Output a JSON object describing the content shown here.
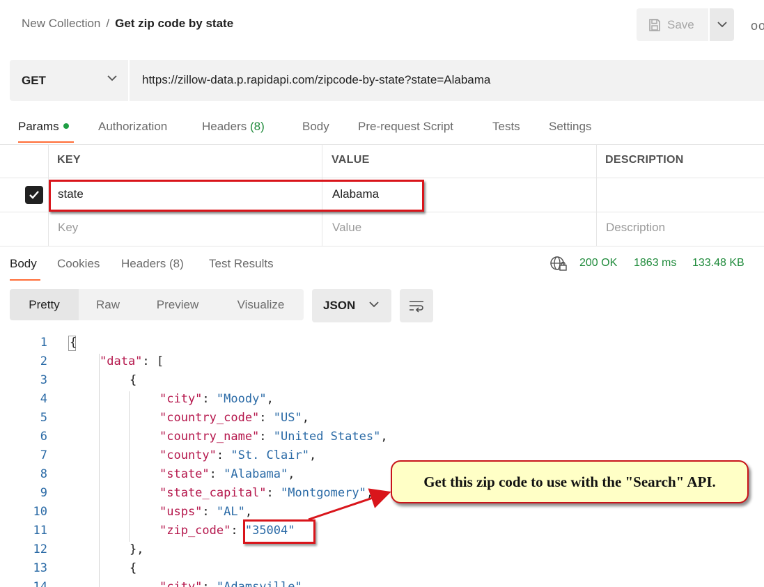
{
  "breadcrumb": {
    "collection": "New Collection",
    "separator": "/",
    "request": "Get zip code by state"
  },
  "toolbar": {
    "save_label": "Save",
    "more_label": "ooo"
  },
  "request": {
    "method": "GET",
    "url": "https://zillow-data.p.rapidapi.com/zipcode-by-state?state=Alabama"
  },
  "request_tabs": [
    {
      "label": "Params"
    },
    {
      "label": "Authorization"
    },
    {
      "label": "Headers",
      "count": "(8)"
    },
    {
      "label": "Body"
    },
    {
      "label": "Pre-request Script"
    },
    {
      "label": "Tests"
    },
    {
      "label": "Settings"
    }
  ],
  "params": {
    "headers": {
      "key": "KEY",
      "value": "VALUE",
      "description": "DESCRIPTION"
    },
    "rows": [
      {
        "key": "state",
        "value": "Alabama",
        "description": "",
        "checked": true
      }
    ],
    "placeholders": {
      "key": "Key",
      "value": "Value",
      "description": "Description"
    }
  },
  "response_tabs": [
    {
      "label": "Body"
    },
    {
      "label": "Cookies"
    },
    {
      "label": "Headers",
      "count": "(8)"
    },
    {
      "label": "Test Results"
    }
  ],
  "response_status": {
    "code": "200 OK",
    "time": "1863 ms",
    "size": "133.48 KB"
  },
  "view_modes": [
    "Pretty",
    "Raw",
    "Preview",
    "Visualize"
  ],
  "format": "JSON",
  "code_lines": [
    {
      "n": "1",
      "text": "{"
    },
    {
      "n": "2",
      "key": "\"data\"",
      "rest": ": ["
    },
    {
      "n": "3",
      "text": "{"
    },
    {
      "n": "4",
      "key": "\"city\"",
      "sep": ": ",
      "val": "\"Moody\"",
      "tail": ","
    },
    {
      "n": "5",
      "key": "\"country_code\"",
      "sep": ": ",
      "val": "\"US\"",
      "tail": ","
    },
    {
      "n": "6",
      "key": "\"country_name\"",
      "sep": ": ",
      "val": "\"United States\"",
      "tail": ","
    },
    {
      "n": "7",
      "key": "\"county\"",
      "sep": ": ",
      "val": "\"St. Clair\"",
      "tail": ","
    },
    {
      "n": "8",
      "key": "\"state\"",
      "sep": ": ",
      "val": "\"Alabama\"",
      "tail": ","
    },
    {
      "n": "9",
      "key": "\"state_capital\"",
      "sep": ": ",
      "val": "\"Montgomery\"",
      "tail": ","
    },
    {
      "n": "10",
      "key": "\"usps\"",
      "sep": ": ",
      "val": "\"AL\"",
      "tail": ","
    },
    {
      "n": "11",
      "key": "\"zip_code\"",
      "sep": ": ",
      "val": "\"35004\"",
      "tail": ""
    },
    {
      "n": "12",
      "text": "},"
    },
    {
      "n": "13",
      "text": "{"
    },
    {
      "n": "14",
      "key": "\"city\"",
      "sep": ": ",
      "val": "\"Adamsville\"",
      "tail": ","
    }
  ],
  "callout": {
    "text": "Get this zip code to use with the \"Search\" API."
  },
  "colors": {
    "accent": "#ff6c37",
    "status_green": "#1e8a3a",
    "annotation_red": "#d9151b",
    "callout_bg": "#ffffc6"
  },
  "icons": {
    "save": "save-icon",
    "chevron": "chevron-down-icon",
    "globe": "globe-lock-icon",
    "wrap": "wrap-lines-icon",
    "check": "checkmark-icon"
  }
}
